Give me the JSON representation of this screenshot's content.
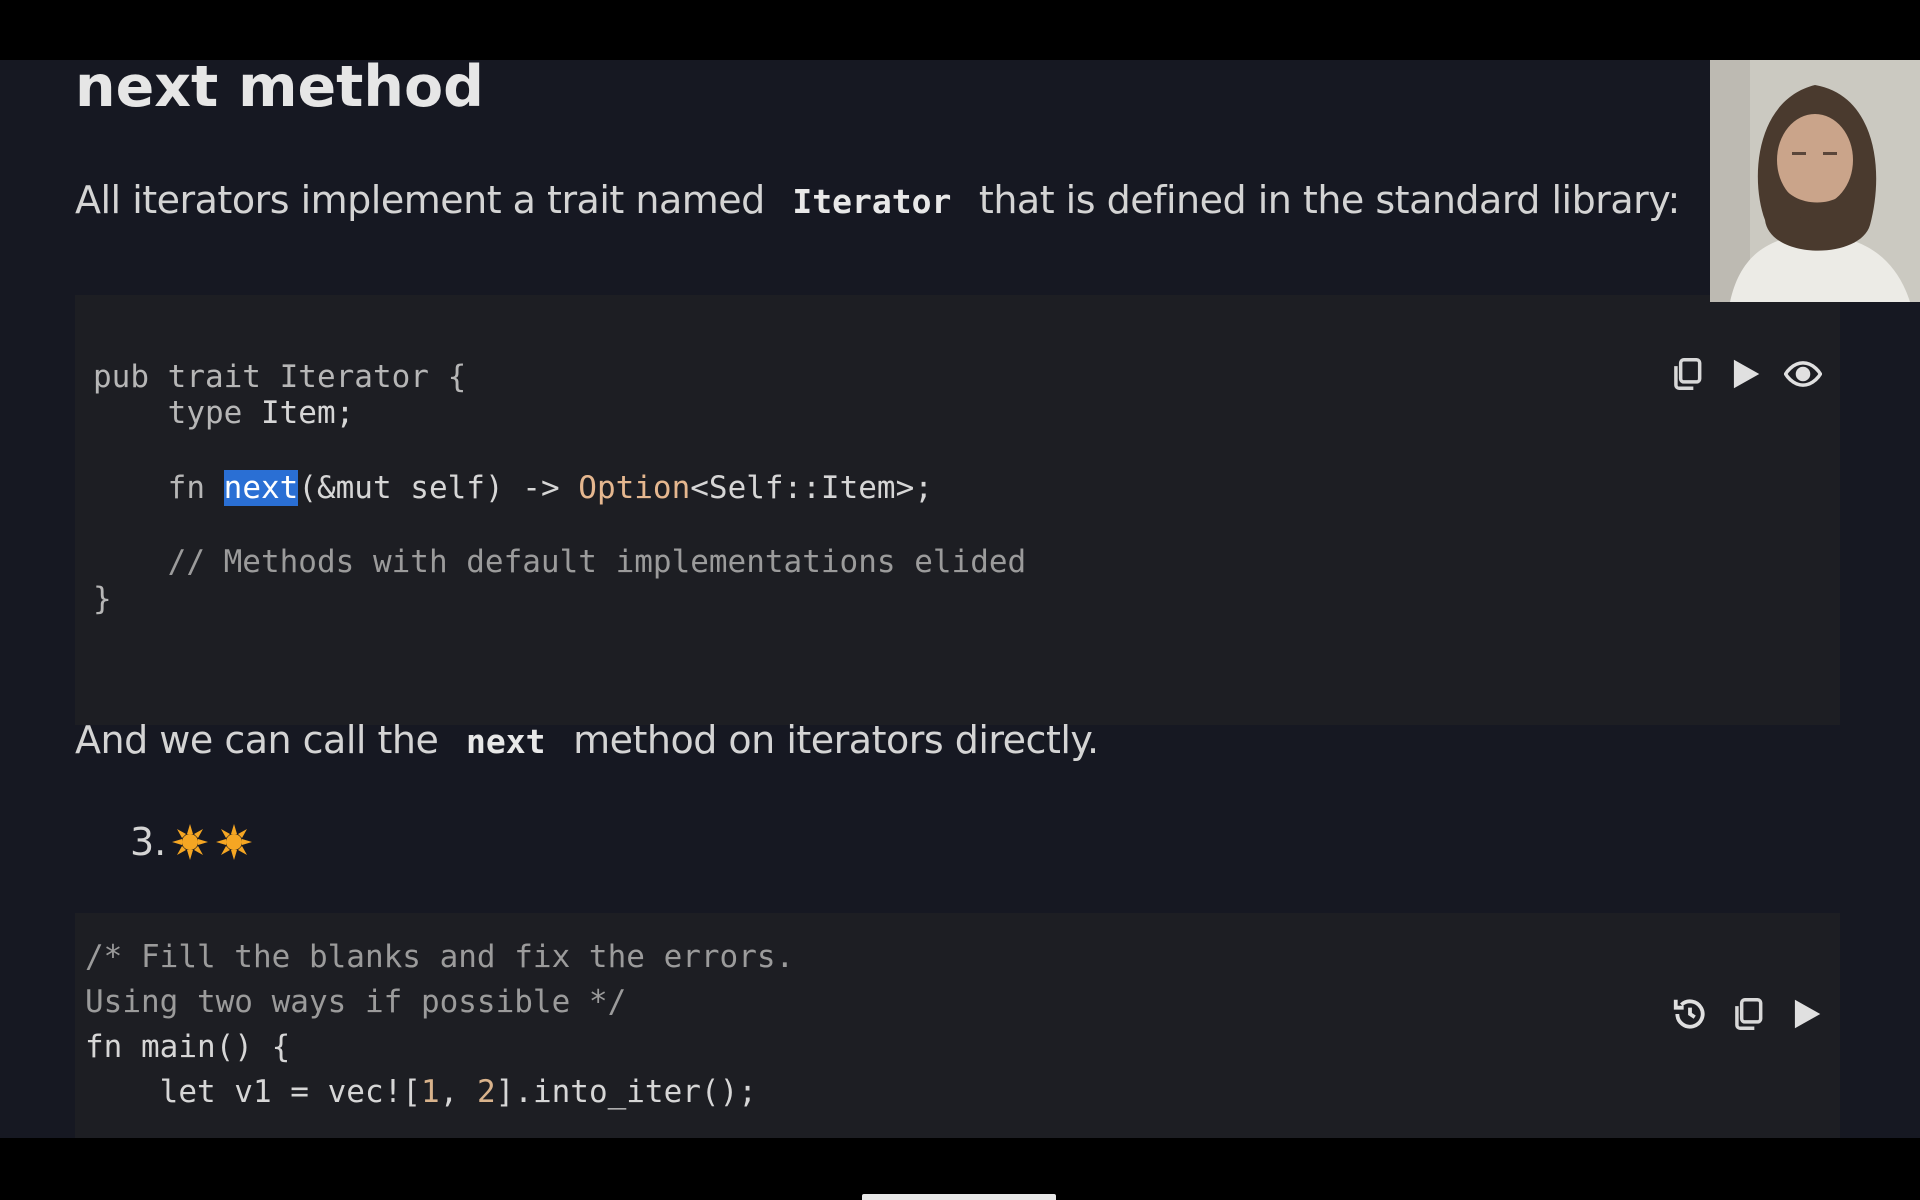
{
  "page": {
    "title": "next method",
    "intro_before": "All iterators implement a trait named",
    "intro_code": "Iterator",
    "intro_after": "that is defined in the standard library:",
    "call_before": "And we can call the",
    "call_code": "next",
    "call_after": "method on iterators directly.",
    "list_number": "3.",
    "difficulty_stars": 2
  },
  "code_block_1": {
    "lines": [
      [
        "pub trait Iterator {"
      ],
      [
        "    type Item;"
      ],
      [
        ""
      ],
      [
        "    fn ",
        "next",
        "(&mut self) -> ",
        "Option",
        "<Self::Item>;"
      ],
      [
        ""
      ],
      [
        "    // Methods with default implementations elided"
      ],
      [
        "}"
      ]
    ],
    "line_1": "pub trait Iterator {",
    "line_2_type": "    type ",
    "line_2_item": "Item;",
    "line_4_fn": "    fn ",
    "line_4_next": "next",
    "line_4_args": "(&mut self) -> ",
    "line_4_option": "Option",
    "line_4_ret": "<Self::Item>;",
    "line_6": "    // Methods with default implementations elided",
    "line_7": "}",
    "toolbar": [
      "copy-icon",
      "play-icon",
      "eye-icon"
    ]
  },
  "code_block_2": {
    "line_1": "/* Fill the blanks and fix the errors.",
    "line_2": "Using two ways if possible */",
    "line_3": "fn main() {",
    "line_4_pre": "    let v1 = vec![",
    "line_4_n1": "1",
    "line_4_mid": ", ",
    "line_4_n2": "2",
    "line_4_post": "].into_iter();",
    "toolbar": [
      "undo-icon",
      "copy-icon",
      "play-icon"
    ]
  },
  "colors": {
    "background": "#161822",
    "code_background": "#1d1e23",
    "selection": "#2a6fd4",
    "option_type": "#e5b78f",
    "star": "#f5a623"
  }
}
